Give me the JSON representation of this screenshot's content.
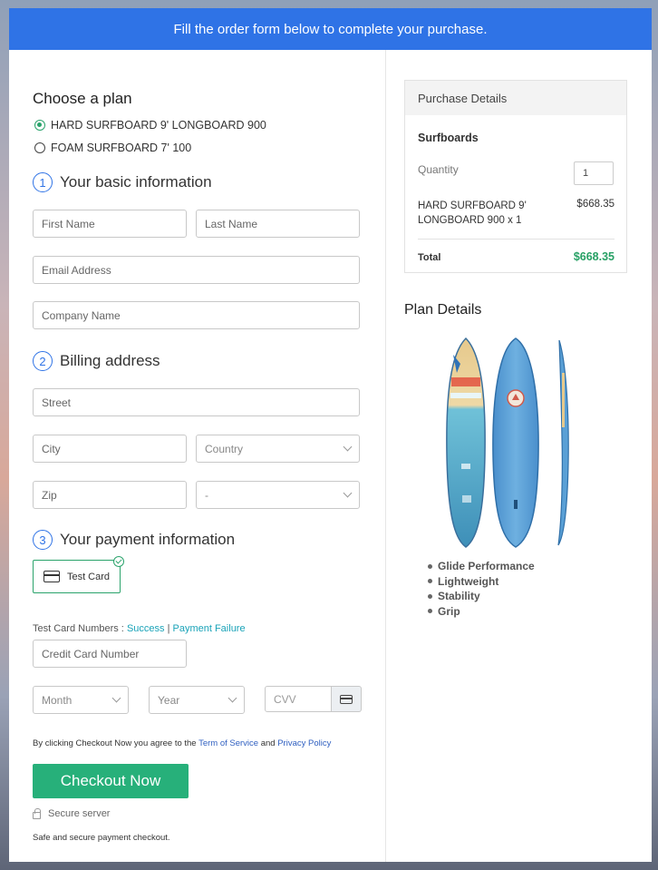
{
  "banner": {
    "text": "Fill the order form below to complete your purchase."
  },
  "plan": {
    "title": "Choose a plan",
    "options": [
      {
        "label": "HARD SURFBOARD 9' LONGBOARD 900",
        "selected": true
      },
      {
        "label": "FOAM SURFBOARD 7' 100",
        "selected": false
      }
    ]
  },
  "basic": {
    "number": "1",
    "title": "Your basic information",
    "first_name_placeholder": "First Name",
    "last_name_placeholder": "Last Name",
    "email_placeholder": "Email Address",
    "company_placeholder": "Company Name"
  },
  "billing": {
    "number": "2",
    "title": "Billing address",
    "street_placeholder": "Street",
    "city_placeholder": "City",
    "country_value": "Country",
    "zip_placeholder": "Zip",
    "state_value": "-"
  },
  "payment": {
    "number": "3",
    "title": "Your payment information",
    "card_option_label": "Test Card",
    "test_numbers_label": "Test Card Numbers :",
    "success_link": "Success",
    "separator": "|",
    "failure_link": "Payment Failure",
    "cc_placeholder": "Credit Card Number",
    "month_value": "Month",
    "year_value": "Year",
    "cvv_placeholder": "CVV"
  },
  "agreement": {
    "prefix": "By clicking Checkout Now you agree to the",
    "terms_link": "Term of Service",
    "and": "and",
    "privacy_link": "Privacy Policy"
  },
  "checkout": {
    "label": "Checkout Now"
  },
  "secure": {
    "label": "Secure server",
    "note": "Safe and secure payment checkout."
  },
  "purchase": {
    "title": "Purchase Details",
    "category": "Surfboards",
    "quantity_label": "Quantity",
    "quantity_value": "1",
    "item_name": "HARD SURFBOARD 9' LONGBOARD 900 x 1",
    "item_price": "$668.35",
    "total_label": "Total",
    "total_value": "$668.35"
  },
  "plan_details": {
    "title": "Plan Details",
    "features": [
      "Glide Performance",
      "Lightweight",
      "Stability",
      "Grip"
    ]
  },
  "colors": {
    "accent": "#2f73e6",
    "success": "#27b07a",
    "total": "#27a065",
    "link": "#1aa3b8"
  }
}
